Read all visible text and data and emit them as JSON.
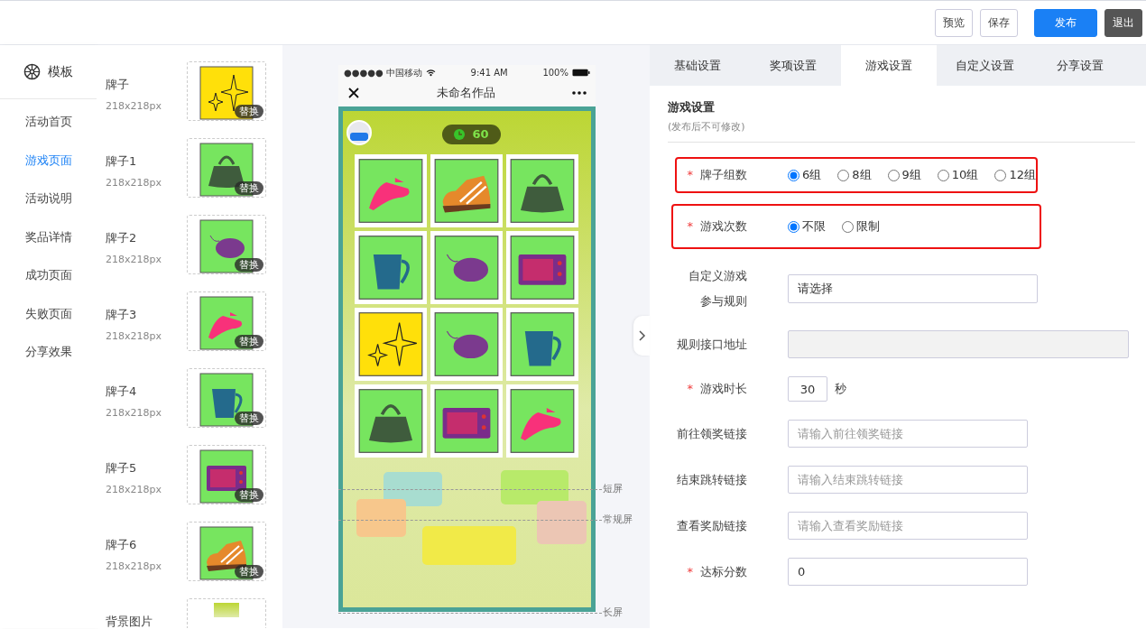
{
  "topbar": {
    "buttons": [
      {
        "label": "预览",
        "kind": "outline"
      },
      {
        "label": "保存",
        "kind": "outline"
      },
      {
        "label": "发布",
        "kind": "primary"
      },
      {
        "label": "退出",
        "kind": "dark"
      }
    ]
  },
  "sidebar": {
    "title": "模板",
    "items": [
      {
        "label": "活动首页",
        "selected": false
      },
      {
        "label": "游戏页面",
        "selected": true
      },
      {
        "label": "活动说明",
        "selected": false
      },
      {
        "label": "奖品详情",
        "selected": false
      },
      {
        "label": "成功页面",
        "selected": false
      },
      {
        "label": "失败页面",
        "selected": false
      },
      {
        "label": "分享效果",
        "selected": false
      }
    ]
  },
  "assets": [
    {
      "name": "牌子",
      "size": "218x218px",
      "action": "替换"
    },
    {
      "name": "牌子1",
      "size": "218x218px",
      "action": "替换"
    },
    {
      "name": "牌子2",
      "size": "218x218px",
      "action": "替换"
    },
    {
      "name": "牌子3",
      "size": "218x218px",
      "action": "替换"
    },
    {
      "name": "牌子4",
      "size": "218x218px",
      "action": "替换"
    },
    {
      "name": "牌子5",
      "size": "218x218px",
      "action": "替换"
    },
    {
      "name": "牌子6",
      "size": "218x218px",
      "action": "替换"
    },
    {
      "name": "背景图片"
    }
  ],
  "phone": {
    "carrier": "●●●●● 中国移动",
    "time": "9:41 AM",
    "battery": "100%",
    "title": "未命名作品",
    "timer": "60"
  },
  "screen_markers": [
    {
      "label": "短屏"
    },
    {
      "label": "常规屏"
    },
    {
      "label": "长屏"
    }
  ],
  "tabs": [
    {
      "label": "基础设置",
      "selected": false
    },
    {
      "label": "奖项设置",
      "selected": false
    },
    {
      "label": "游戏设置",
      "selected": true
    },
    {
      "label": "自定义设置",
      "selected": false
    },
    {
      "label": "分享设置",
      "selected": false
    }
  ],
  "section": {
    "title": "游戏设置",
    "note": "(发布后不可修改)"
  },
  "fields": [
    {
      "kind": "radio",
      "required_mark": "*",
      "label": "牌子组数",
      "highlighted": true,
      "options": [
        {
          "label": "6组",
          "selected": true
        },
        {
          "label": "8组",
          "selected": false
        },
        {
          "label": "9组",
          "selected": false
        },
        {
          "label": "10组",
          "selected": false
        },
        {
          "label": "12组",
          "selected": false
        }
      ]
    },
    {
      "kind": "radio",
      "required_mark": "*",
      "label": "游戏次数",
      "highlighted": true,
      "options": [
        {
          "label": "不限",
          "selected": true
        },
        {
          "label": "限制",
          "selected": false
        }
      ]
    },
    {
      "kind": "select",
      "label_lines": [
        "自定义游戏",
        "参与规则"
      ],
      "highlighted": false,
      "value": "请选择"
    },
    {
      "kind": "text",
      "label": "规则接口地址",
      "highlighted": false,
      "disabled": true
    },
    {
      "kind": "number",
      "required_mark": "*",
      "label": "游戏时长",
      "highlighted": false,
      "value": "30",
      "unit": "秒"
    },
    {
      "kind": "text",
      "label": "前往领奖链接",
      "highlighted": false,
      "placeholder": "请输入前往领奖链接"
    },
    {
      "kind": "text",
      "label": "结束跳转链接",
      "highlighted": false,
      "placeholder": "请输入结束跳转链接"
    },
    {
      "kind": "text",
      "label": "查看奖励链接",
      "highlighted": false,
      "placeholder": "请输入查看奖励链接"
    },
    {
      "kind": "text",
      "required_mark": "*",
      "label": "达标分数",
      "highlighted": false,
      "value": "0"
    }
  ]
}
